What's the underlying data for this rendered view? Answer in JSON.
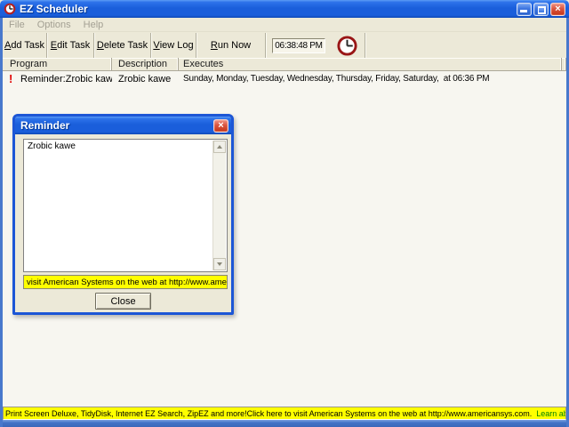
{
  "window": {
    "title": "EZ Scheduler",
    "close_glyph": "×"
  },
  "menu": {
    "items": [
      "File",
      "Options",
      "Help"
    ]
  },
  "toolbar": {
    "buttons": [
      {
        "label": "Add Task"
      },
      {
        "label": "Edit Task"
      },
      {
        "label": "Delete Task"
      },
      {
        "label": "View Log"
      },
      {
        "label": "Run Now"
      }
    ],
    "time": "06:38:48 PM"
  },
  "table": {
    "columns": [
      "Program",
      "Description",
      "Executes"
    ],
    "rows": [
      {
        "icon": "!",
        "program": "Reminder:Zrobic kawe",
        "description": "Zrobic kawe",
        "executes": "Sunday, Monday, Tuesday, Wednesday, Thursday, Friday, Saturday,  at 06:36 PM"
      }
    ]
  },
  "dialog": {
    "title": "Reminder",
    "close_glyph": "×",
    "text": "Zrobic kawe",
    "banner": "visit American Systems on the web at http://www.america",
    "close_button": "Close"
  },
  "marquee": {
    "text_black": "Print Screen Deluxe, TidyDisk, Internet EZ Search, ZipEZ and more!Click here to visit American Systems on the web at http://www.americansys.com.  ",
    "text_green": "Learn about our p"
  },
  "colors": {
    "titlebar_blue": "#1a5edb",
    "window_border_blue": "#4878cc",
    "chrome_beige": "#ece9d8",
    "marquee_yellow": "#ffff00",
    "marquee_green": "#008000",
    "alert_red": "#e00000"
  }
}
